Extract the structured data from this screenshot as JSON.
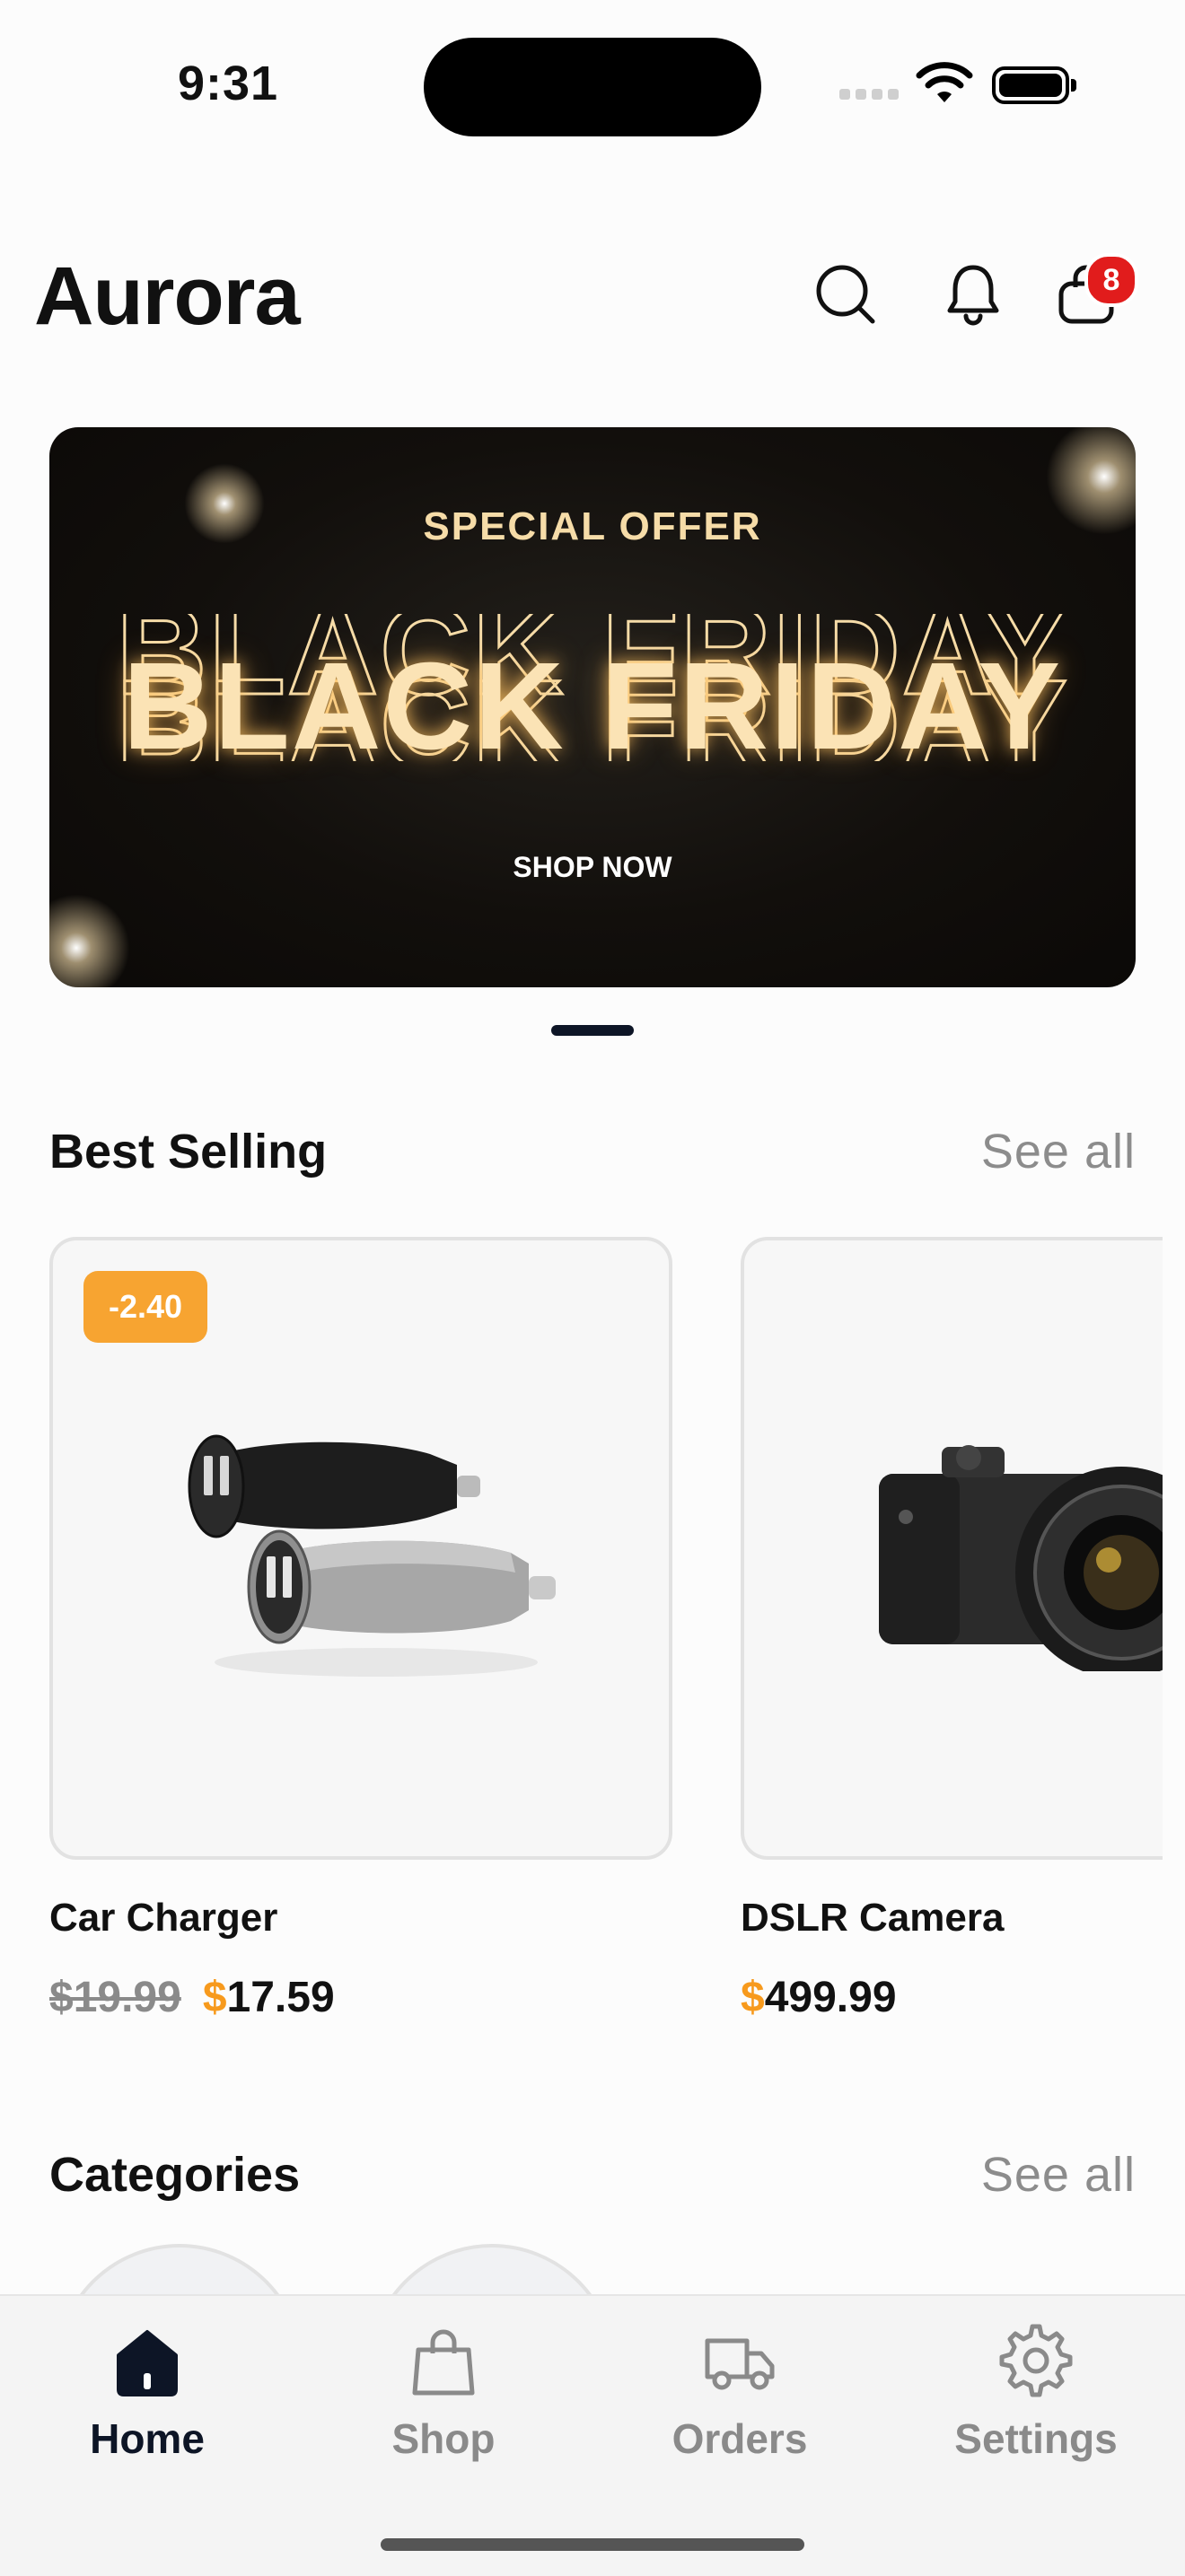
{
  "status_bar": {
    "time": "9:31"
  },
  "header": {
    "title": "Aurora",
    "cart_count": "8"
  },
  "banner": {
    "eyebrow": "SPECIAL OFFER",
    "headline": "BLACK FRIDAY",
    "cta": "SHOP NOW"
  },
  "best_selling": {
    "title": "Best Selling",
    "see_all": "See all",
    "products": [
      {
        "name": "Car Charger",
        "old_price": "$19.99",
        "currency": "$",
        "price": "17.59",
        "discount": "-2.40"
      },
      {
        "name": "DSLR Camera",
        "currency": "$",
        "price": "499.99"
      }
    ]
  },
  "categories": {
    "title": "Categories",
    "see_all": "See all"
  },
  "tabs": [
    {
      "label": "Home",
      "icon": "home-icon",
      "active": true
    },
    {
      "label": "Shop",
      "icon": "shopping-bag-icon",
      "active": false
    },
    {
      "label": "Orders",
      "icon": "truck-icon",
      "active": false
    },
    {
      "label": "Settings",
      "icon": "gear-icon",
      "active": false
    }
  ],
  "colors": {
    "accent": "#f79a1d",
    "badge": "#e11c1c",
    "active_tab": "#0d1526",
    "banner_text": "#f6dca8"
  }
}
